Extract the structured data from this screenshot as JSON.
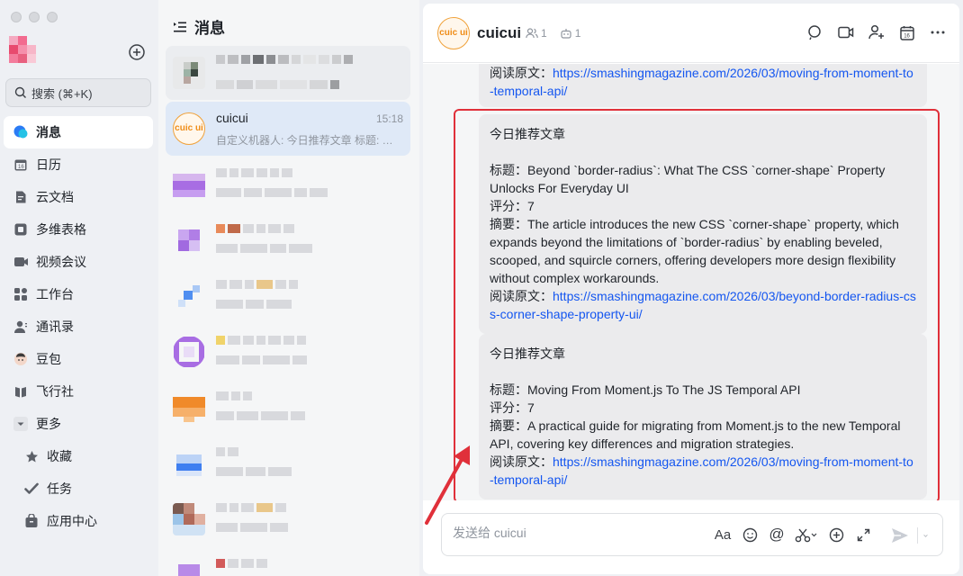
{
  "sidebar": {
    "search_label": "搜索 (⌘+K)",
    "items": [
      {
        "label": "消息",
        "icon": "message-icon",
        "active": true
      },
      {
        "label": "日历",
        "icon": "calendar-icon"
      },
      {
        "label": "云文档",
        "icon": "cloud-doc-icon"
      },
      {
        "label": "多维表格",
        "icon": "base-table-icon"
      },
      {
        "label": "视频会议",
        "icon": "video-meeting-icon"
      },
      {
        "label": "工作台",
        "icon": "workplace-icon"
      },
      {
        "label": "通讯录",
        "icon": "contacts-icon"
      },
      {
        "label": "豆包",
        "icon": "doubao-icon"
      },
      {
        "label": "飞行社",
        "icon": "flight-club-icon"
      },
      {
        "label": "更多",
        "icon": "chevron-down-icon"
      },
      {
        "label": "收藏",
        "icon": "star-icon"
      },
      {
        "label": "任务",
        "icon": "task-check-icon"
      },
      {
        "label": "应用中心",
        "icon": "app-center-icon"
      }
    ]
  },
  "chatlist": {
    "title": "消息",
    "active_chat": {
      "avatar_text": "cuic ui",
      "name": "cuicui",
      "time": "15:18",
      "preview": "自定义机器人: 今日推荐文章 标题: Moving From Moment.js To The JS Temporal API"
    }
  },
  "chat": {
    "title": "cuicui",
    "avatar_text": "cuic ui",
    "member_count": "1",
    "bot_count": "1",
    "top_message": {
      "label": "阅读原文：",
      "url": "https://smashingmagazine.com/2026/03/moving-from-moment-to-temporal-api/"
    },
    "messages": [
      {
        "heading": "今日推荐文章",
        "title_label": "标题：",
        "title": "Beyond `border-radius`: What The CSS `corner-shape` Property Unlocks For Everyday UI",
        "score_label": "评分：",
        "score": "7",
        "summary_label": "摘要：",
        "summary": "The article introduces the new CSS `corner-shape` property, which expands beyond the limitations of `border-radius` by enabling beveled, scooped, and squircle corners, offering developers more design flexibility without complex workarounds.",
        "link_label": "阅读原文：",
        "url": "https://smashingmagazine.com/2026/03/beyond-border-radius-css-corner-shape-property-ui/"
      },
      {
        "heading": "今日推荐文章",
        "title_label": "标题：",
        "title": "Moving From Moment.js To The JS Temporal API",
        "score_label": "评分：",
        "score": "7",
        "summary_label": "摘要：",
        "summary": "A practical guide for migrating from Moment.js to the new Temporal API, covering key differences and migration strategies.",
        "link_label": "阅读原文：",
        "url": "https://smashingmagazine.com/2026/03/moving-from-moment-to-temporal-api/"
      }
    ],
    "composer_placeholder": "发送给 cuicui"
  },
  "colors": {
    "accent": "#1456f0",
    "highlight": "#e0303a",
    "bot_avatar": "#ef8c17"
  }
}
